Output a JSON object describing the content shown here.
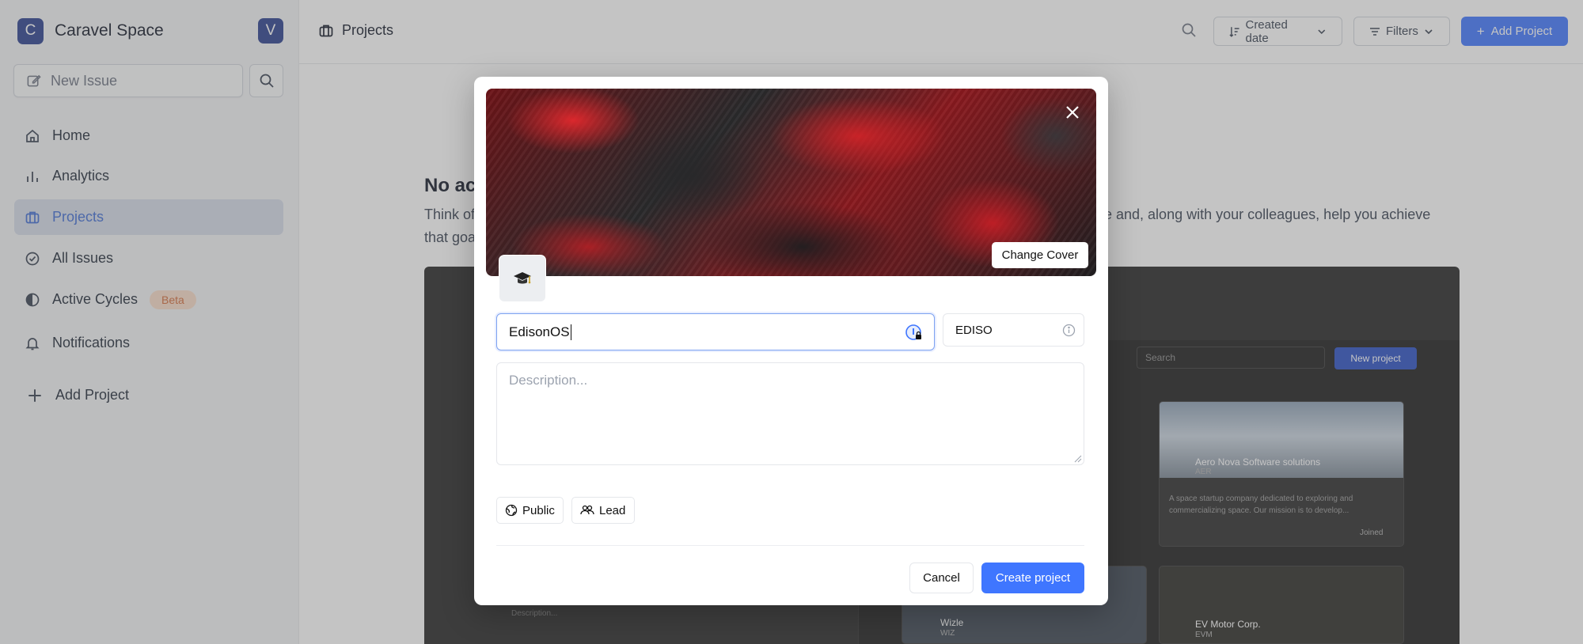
{
  "workspace": {
    "initial": "C",
    "name": "Caravel Space",
    "user_initial": "V"
  },
  "sidebar": {
    "new_issue_label": "New Issue",
    "items": [
      {
        "label": "Home"
      },
      {
        "label": "Analytics"
      },
      {
        "label": "Projects"
      },
      {
        "label": "All Issues"
      },
      {
        "label": "Active Cycles",
        "badge": "Beta"
      },
      {
        "label": "Notifications"
      }
    ],
    "add_project_label": "Add Project"
  },
  "header": {
    "breadcrumb": "Projects",
    "sort_label": "Created date",
    "filters_label": "Filters",
    "add_project_label": "Add Project"
  },
  "background": {
    "empty_title": "No ac",
    "empty_desc_left": "Think of",
    "empty_desc_left2": "that goa",
    "empty_desc_right": "ive and, along with your colleagues, help you achieve",
    "preview": {
      "search_placeholder": "Search",
      "new_project_label": "New project",
      "cards": [
        {
          "name": "Aero Nova Software solutions",
          "id": "AER",
          "desc": "A space startup company dedicated to exploring and commercializing space. Our mission is to develop...",
          "status": "Joined"
        },
        {
          "name": "Wizle",
          "id": "WIZ"
        },
        {
          "name": "EV Motor Corp.",
          "id": "EVM"
        }
      ],
      "desc_placeholder": "Description..."
    }
  },
  "modal": {
    "change_cover_label": "Change Cover",
    "project_name_value": "EdisonOS",
    "identifier_value": "EDISO",
    "description_placeholder": "Description...",
    "network_label": "Public",
    "lead_label": "Lead",
    "cancel_label": "Cancel",
    "create_label": "Create project"
  },
  "colors": {
    "accent": "#3f76ff",
    "workspace_logo": "#2a3f8f",
    "beta_bg": "#f9dcc8",
    "beta_text": "#d26b3b"
  }
}
